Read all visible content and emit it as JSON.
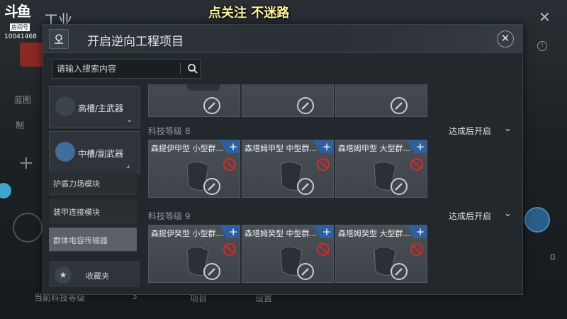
{
  "background": {
    "title": "工业",
    "label_blueprint": "蓝图",
    "label_make": "制",
    "plus": "+",
    "status_label": "当前科技等级",
    "status_value": "3",
    "button_1": "项目",
    "button_2": "设置",
    "close": "✕",
    "badge": "!",
    "zero": "0"
  },
  "watermark": {
    "logo": "斗鱼",
    "tag": "房间号",
    "room_id": "10041468"
  },
  "banner": "点关注 不迷路",
  "modal": {
    "title": "开启逆向工程项目",
    "close": "✕",
    "search": {
      "placeholder": "请输入搜索内容"
    }
  },
  "categories": {
    "main": [
      {
        "label": "高槽/主武器"
      },
      {
        "label": "中槽/副武器"
      }
    ],
    "sub": [
      {
        "label": "护盾力场模块",
        "active": false
      },
      {
        "label": "装甲连接模块",
        "active": false
      },
      {
        "label": "群体电容传输器",
        "active": true
      }
    ],
    "favorites": "收藏夹"
  },
  "sections": [
    {
      "title": "科技等级 8",
      "status": "达成后开启",
      "items": [
        {
          "name": "森提伊甲型 小型群..."
        },
        {
          "name": "森塔姆甲型 中型群..."
        },
        {
          "name": "森塔姆甲型 大型群..."
        }
      ]
    },
    {
      "title": "科技等级 9",
      "status": "达成后开启",
      "items": [
        {
          "name": "森提伊癸型 小型群..."
        },
        {
          "name": "森塔姆癸型 中型群..."
        },
        {
          "name": "森塔姆癸型 大型群..."
        }
      ]
    }
  ],
  "colors": {
    "accent_blue": "#2f5f9e",
    "ban_red": "#d02a2a",
    "banner_yellow": "#fff3a0"
  }
}
